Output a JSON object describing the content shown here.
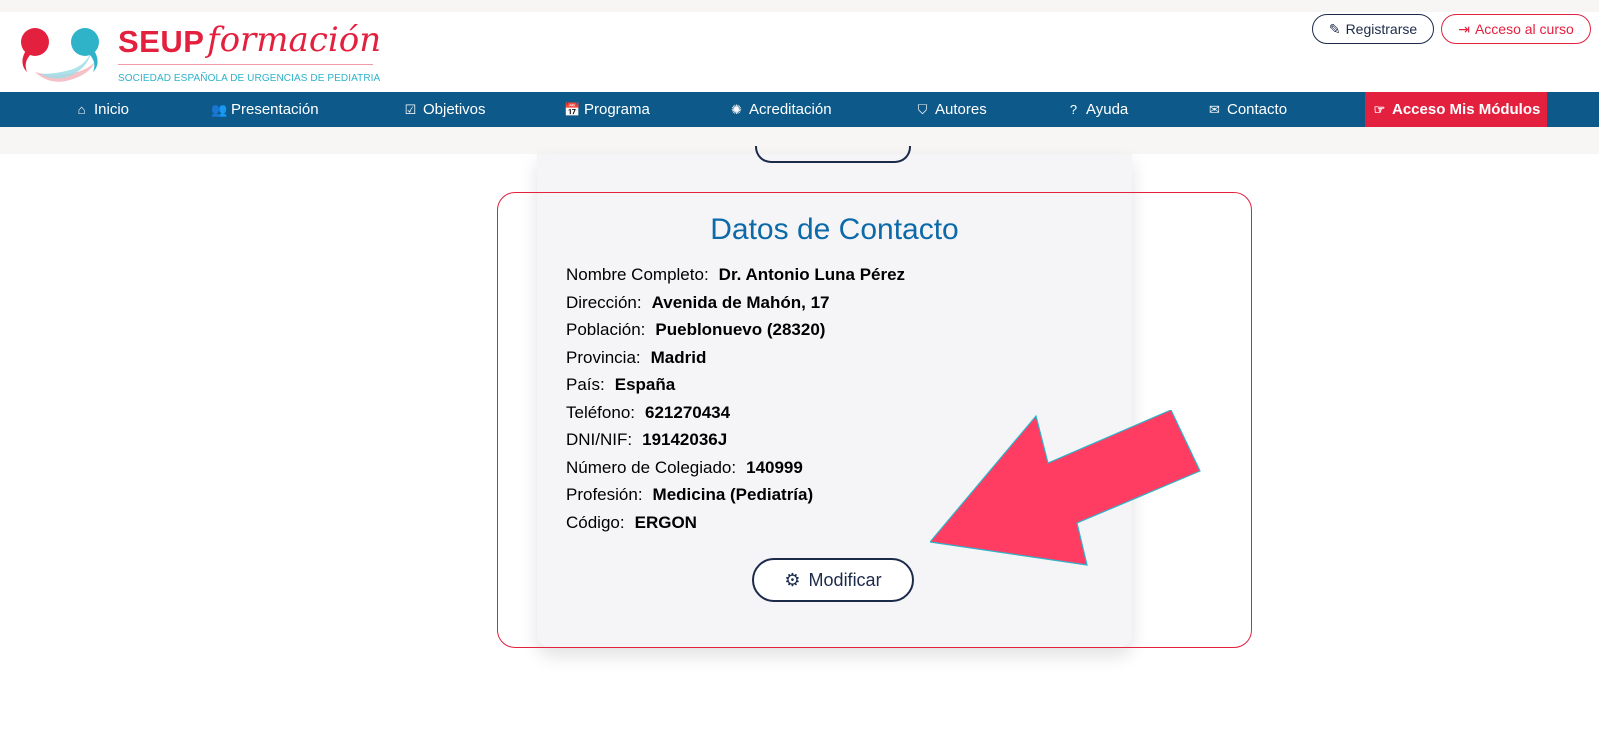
{
  "header": {
    "brand": "SEUP",
    "brand_script": "formación",
    "brand_subtitle": "SOCIEDAD ESPAÑOLA DE URGENCIAS DE PEDIATRIA",
    "register_label": "Registrarse",
    "register_icon": "pencil-icon",
    "access_label": "Acceso al curso",
    "access_icon": "sign-in-icon"
  },
  "nav": {
    "items": [
      {
        "label": "Inicio",
        "icon": "home-icon",
        "glyph": "⌂"
      },
      {
        "label": "Presentación",
        "icon": "users-icon",
        "glyph": "👥"
      },
      {
        "label": "Objetivos",
        "icon": "checkbox-icon",
        "glyph": "☑"
      },
      {
        "label": "Programa",
        "icon": "calendar-check-icon",
        "glyph": "📅"
      },
      {
        "label": "Acreditación",
        "icon": "certificate-icon",
        "glyph": "✺"
      },
      {
        "label": "Autores",
        "icon": "shield-icon",
        "glyph": "⛉"
      },
      {
        "label": "Ayuda",
        "icon": "question-circle-icon",
        "glyph": "?"
      },
      {
        "label": "Contacto",
        "icon": "envelope-icon",
        "glyph": "✉"
      },
      {
        "label": "Acceso Mis Módulos",
        "icon": "hand-point-icon",
        "glyph": "☞"
      }
    ],
    "active_color": "#e4203f",
    "bar_color": "#0d5a8a"
  },
  "card": {
    "title": "Datos de Contacto",
    "fields": [
      {
        "label": "Nombre Completo:",
        "value": "Dr. Antonio Luna Pérez"
      },
      {
        "label": "Dirección:",
        "value": "Avenida de Mahón, 17"
      },
      {
        "label": "Población:",
        "value": "Pueblonuevo (28320)"
      },
      {
        "label": "Provincia:",
        "value": "Madrid"
      },
      {
        "label": "País:",
        "value": "España"
      },
      {
        "label": "Teléfono:",
        "value": "621270434"
      },
      {
        "label": "DNI/NIF:",
        "value": "19142036J"
      },
      {
        "label": "Número de Colegiado:",
        "value": "140999"
      },
      {
        "label": "Profesión:",
        "value": "Medicina (Pediatría)"
      },
      {
        "label": "Código:",
        "value": "ERGON"
      }
    ],
    "modify_label": "Modificar",
    "modify_icon": "gear-icon"
  },
  "colors": {
    "accent_red": "#e4203f",
    "title_blue": "#0d6aa8",
    "annotation_arrow": "#ff3d63"
  }
}
